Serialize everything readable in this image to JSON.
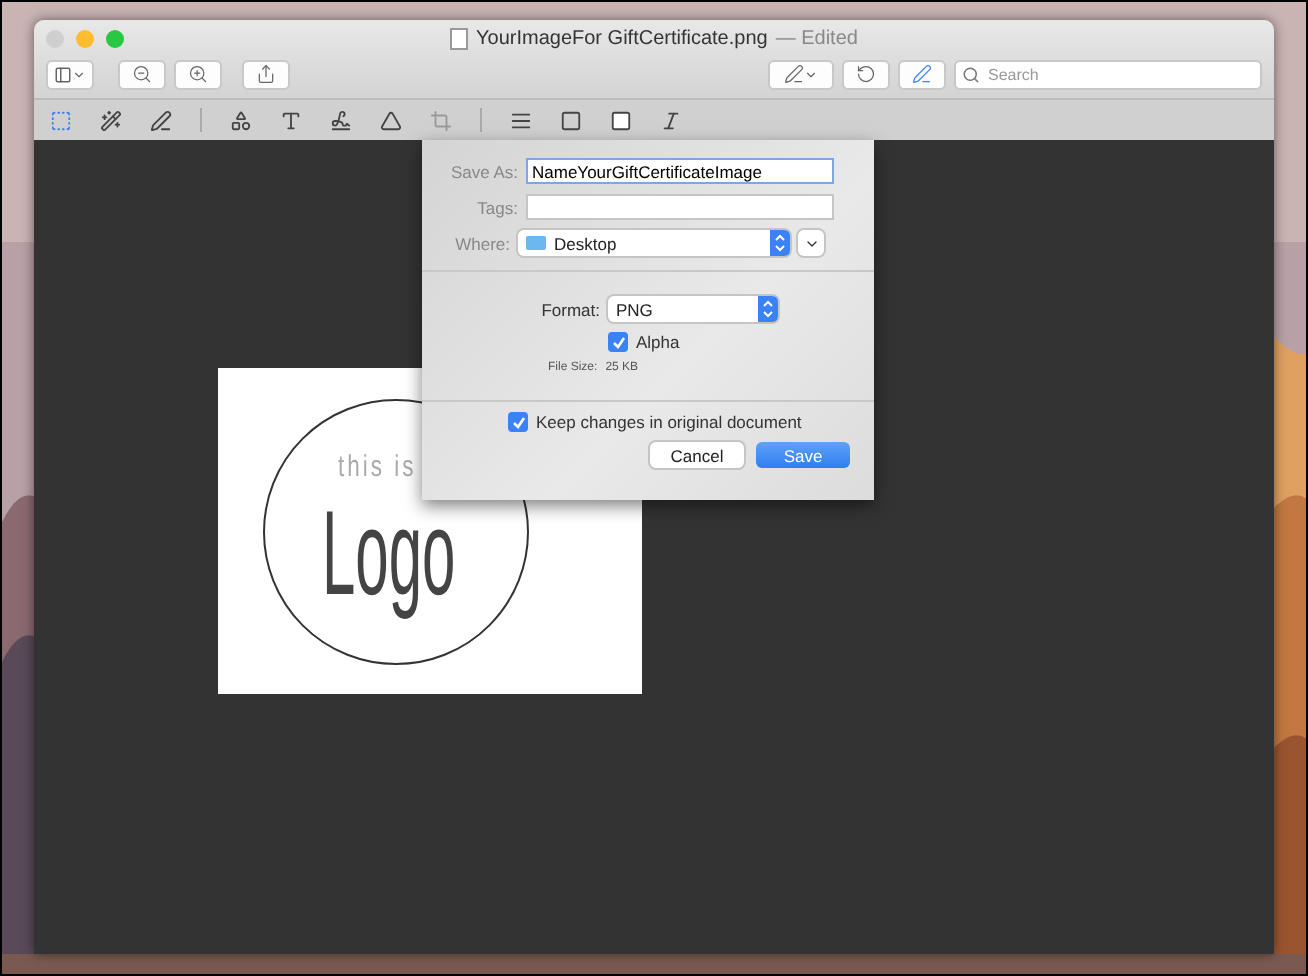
{
  "window": {
    "title": "YourImageFor GiftCertificate.png",
    "status": "— Edited",
    "close_enabled": false
  },
  "toolbar": {
    "search": {
      "placeholder": "Search"
    }
  },
  "document": {
    "tagline": "this is",
    "logo": "Logo"
  },
  "save_sheet": {
    "save_as": {
      "label": "Save As:",
      "value": "NameYourGiftCertificateImage"
    },
    "tags": {
      "label": "Tags:"
    },
    "where": {
      "label": "Where:",
      "value": "Desktop"
    },
    "format": {
      "label": "Format:",
      "value": "PNG"
    },
    "alpha": {
      "label": "Alpha",
      "checked": true
    },
    "file_size": {
      "label": "File Size:",
      "value": "25 KB"
    },
    "keep_changes": {
      "label": "Keep changes in original document",
      "checked": true
    },
    "buttons": [
      {
        "label": "Cancel",
        "kind": "secondary"
      },
      {
        "label": "Save",
        "kind": "primary"
      }
    ]
  }
}
